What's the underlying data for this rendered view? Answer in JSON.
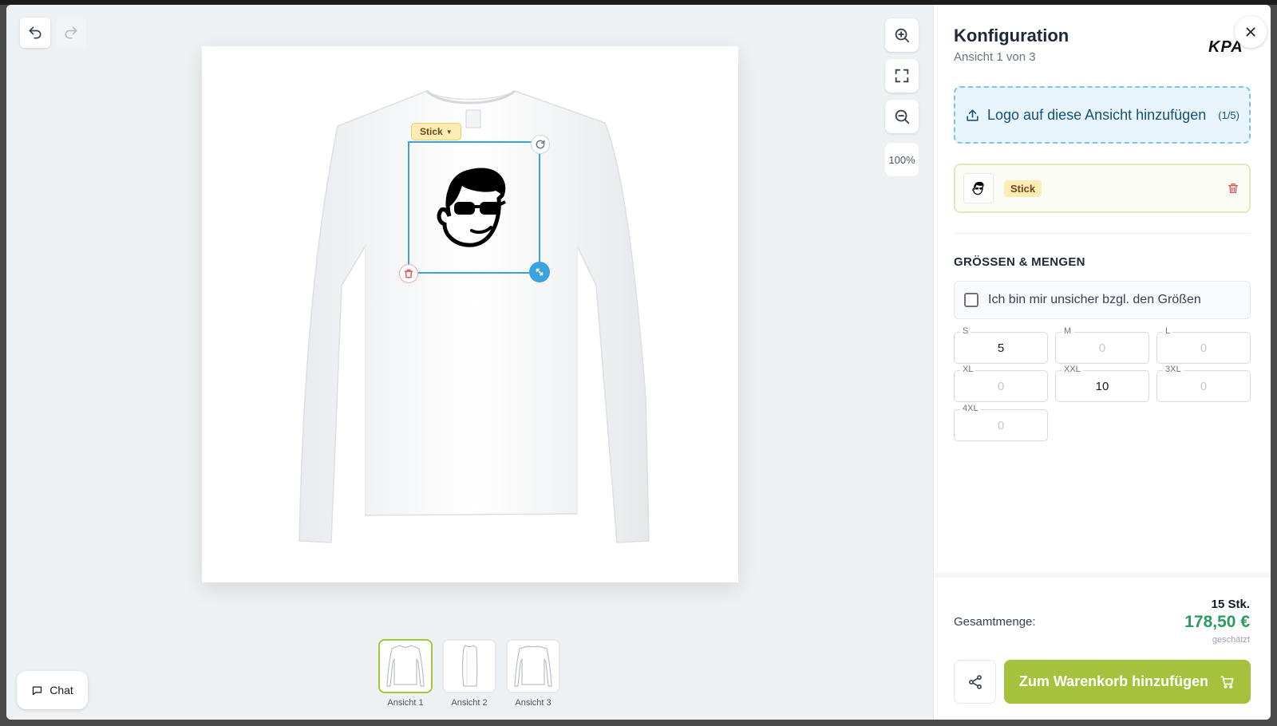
{
  "panel": {
    "title": "Konfiguration",
    "subtitle": "Ansicht 1 von 3",
    "brand_logo_text": "KPA",
    "upload": {
      "label": "Logo auf diese Ansicht hinzufügen",
      "count": "(1/5)"
    },
    "logo_item": {
      "method": "Stick"
    },
    "sizes_section_title": "GRÖSSEN & MENGEN",
    "unsure_label": "Ich bin mir unsicher bzgl. den Größen",
    "sizes": [
      {
        "label": "S",
        "value": "5",
        "placeholder": ""
      },
      {
        "label": "M",
        "value": "",
        "placeholder": "0"
      },
      {
        "label": "L",
        "value": "",
        "placeholder": "0"
      },
      {
        "label": "XL",
        "value": "",
        "placeholder": "0"
      },
      {
        "label": "XXL",
        "value": "10",
        "placeholder": ""
      },
      {
        "label": "3XL",
        "value": "",
        "placeholder": "0"
      },
      {
        "label": "4XL",
        "value": "",
        "placeholder": "0"
      }
    ],
    "total": {
      "label": "Gesamtmenge:",
      "quantity": "15 Stk.",
      "price": "178,50 €",
      "note": "geschätzt"
    },
    "cart_button": "Zum Warenkorb hinzufügen"
  },
  "canvas": {
    "zoom_level": "100%",
    "design_method": "Stick",
    "views": [
      {
        "label": "Ansicht 1",
        "active": true
      },
      {
        "label": "Ansicht 2",
        "active": false
      },
      {
        "label": "Ansicht 3",
        "active": false
      }
    ]
  },
  "chat": {
    "label": "Chat"
  },
  "colors": {
    "accent_green": "#a6c23c",
    "price_green": "#2c9b5e",
    "selection_blue": "#3ba4e0",
    "method_badge": "#fdecb5",
    "upload_blue": "#17507a"
  }
}
